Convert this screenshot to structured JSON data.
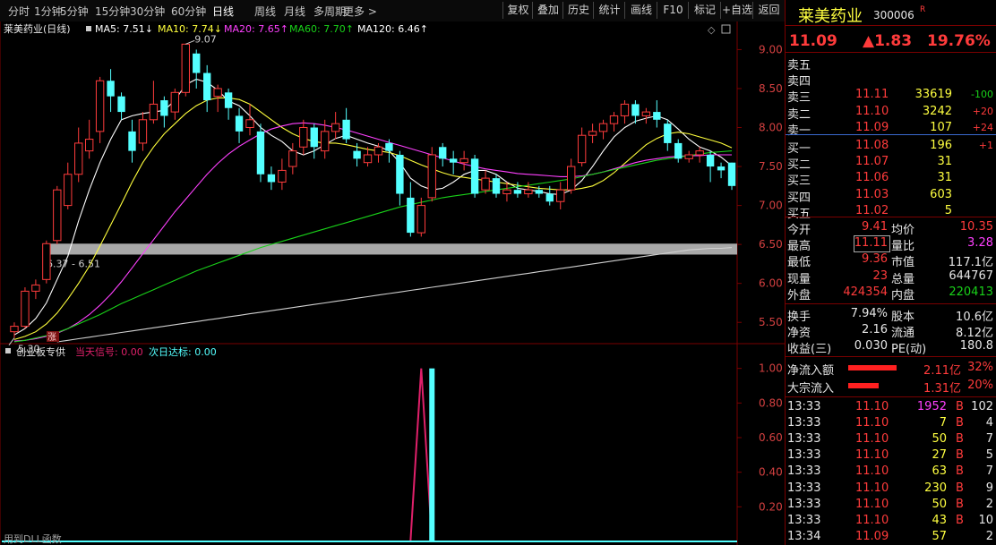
{
  "toolbar": {
    "periods": [
      "分时",
      "1分钟",
      "5分钟",
      "15分钟",
      "30分钟",
      "60分钟",
      "日线",
      "周线",
      "月线",
      "多周期",
      "更多 >"
    ],
    "active_period": "日线",
    "buttons": [
      "复权",
      "叠加",
      "历史",
      "统计",
      "画线",
      "F10",
      "标记",
      "+自选",
      "返回"
    ]
  },
  "chart_header": {
    "stock": "莱美药业(日线)",
    "ma5": "MA5: 7.51↓",
    "ma10": "MA10: 7.74↓",
    "ma20": "MA20: 7.65↑",
    "ma60": "MA60: 7.70↑",
    "ma120": "MA120: 6.46↑"
  },
  "sub_header": {
    "name": "创业板专供",
    "sig1": "当天信号: 0.00",
    "sig2": "次日达标: 0.00"
  },
  "bottom_text": "用到DLL函数",
  "colors": {
    "up": "#ff3c3c",
    "down": "#54ffff",
    "ma5": "#ffffff",
    "ma10": "#ffff3c",
    "ma20": "#ff40ff",
    "ma60": "#19d219",
    "ma120": "#d0d0d0",
    "grid": "#7a0000",
    "signal1": "#e0206a"
  },
  "chart_data": [
    {
      "type": "candlestick",
      "y_ticks": [
        5.5,
        6.0,
        6.5,
        7.0,
        7.5,
        8.0,
        8.5,
        9.0
      ],
      "ylim": [
        5.25,
        9.2
      ],
      "annotations": {
        "high_label": "9.07",
        "low_label": "5.30",
        "zone_label": "6.37 - 6.51",
        "zone": [
          6.37,
          6.51
        ],
        "marker": "涨"
      },
      "candles": [
        [
          5.38,
          5.45,
          5.3,
          5.5
        ],
        [
          5.45,
          5.9,
          5.42,
          5.95
        ],
        [
          5.9,
          5.98,
          5.8,
          6.05
        ],
        [
          6.05,
          6.51,
          6.0,
          6.55
        ],
        [
          6.55,
          7.2,
          6.5,
          7.25
        ],
        [
          7.0,
          7.4,
          6.95,
          7.55
        ],
        [
          7.4,
          7.8,
          7.3,
          8.0
        ],
        [
          7.7,
          7.85,
          7.6,
          8.1
        ],
        [
          7.95,
          8.6,
          7.8,
          8.65
        ],
        [
          8.6,
          8.4,
          8.2,
          8.75
        ],
        [
          8.4,
          8.2,
          8.1,
          8.45
        ],
        [
          7.95,
          7.7,
          7.55,
          8.1
        ],
        [
          7.8,
          8.1,
          7.7,
          8.2
        ],
        [
          8.1,
          8.3,
          8.05,
          8.6
        ],
        [
          8.35,
          8.15,
          8.0,
          8.4
        ],
        [
          8.2,
          8.45,
          8.1,
          8.5
        ],
        [
          8.45,
          9.07,
          8.4,
          9.07
        ],
        [
          8.95,
          8.7,
          8.5,
          9.0
        ],
        [
          8.7,
          8.35,
          8.2,
          8.8
        ],
        [
          8.4,
          8.5,
          8.2,
          8.55
        ],
        [
          8.45,
          8.25,
          8.1,
          8.5
        ],
        [
          8.15,
          7.95,
          7.8,
          8.25
        ],
        [
          8.0,
          8.1,
          7.9,
          8.3
        ],
        [
          7.95,
          7.4,
          7.3,
          8.05
        ],
        [
          7.4,
          7.3,
          7.2,
          7.5
        ],
        [
          7.3,
          7.45,
          7.2,
          7.6
        ],
        [
          7.5,
          7.7,
          7.4,
          7.8
        ],
        [
          7.75,
          8.0,
          7.65,
          8.1
        ],
        [
          8.0,
          7.75,
          7.6,
          8.05
        ],
        [
          7.7,
          7.95,
          7.6,
          8.1
        ],
        [
          7.95,
          8.05,
          7.85,
          8.2
        ],
        [
          8.1,
          7.85,
          7.8,
          8.25
        ],
        [
          7.7,
          7.6,
          7.5,
          7.8
        ],
        [
          7.55,
          7.65,
          7.5,
          7.75
        ],
        [
          7.65,
          7.75,
          7.55,
          7.8
        ],
        [
          7.8,
          7.7,
          7.55,
          7.85
        ],
        [
          7.65,
          7.15,
          7.0,
          7.7
        ],
        [
          7.1,
          6.65,
          6.6,
          7.3
        ],
        [
          6.65,
          7.0,
          6.6,
          7.1
        ],
        [
          7.1,
          7.65,
          7.05,
          7.75
        ],
        [
          7.75,
          7.6,
          7.5,
          7.8
        ],
        [
          7.6,
          7.55,
          7.4,
          7.7
        ],
        [
          7.55,
          7.6,
          7.45,
          7.7
        ],
        [
          7.6,
          7.15,
          7.1,
          7.65
        ],
        [
          7.2,
          7.35,
          7.15,
          7.45
        ],
        [
          7.35,
          7.15,
          7.1,
          7.4
        ],
        [
          7.15,
          7.2,
          7.05,
          7.3
        ],
        [
          7.2,
          7.15,
          7.1,
          7.3
        ],
        [
          7.15,
          7.2,
          7.1,
          7.3
        ],
        [
          7.2,
          7.15,
          7.1,
          7.25
        ],
        [
          7.15,
          7.05,
          7.0,
          7.25
        ],
        [
          7.05,
          7.2,
          6.95,
          7.3
        ],
        [
          7.2,
          7.5,
          7.15,
          7.6
        ],
        [
          7.55,
          7.9,
          7.5,
          8.0
        ],
        [
          7.9,
          7.95,
          7.8,
          8.05
        ],
        [
          7.95,
          8.05,
          7.85,
          8.1
        ],
        [
          8.05,
          8.15,
          7.95,
          8.2
        ],
        [
          8.15,
          8.3,
          8.05,
          8.35
        ],
        [
          8.3,
          8.15,
          8.05,
          8.35
        ],
        [
          8.15,
          8.2,
          8.05,
          8.25
        ],
        [
          8.2,
          8.1,
          8.0,
          8.35
        ],
        [
          8.05,
          7.8,
          7.7,
          8.1
        ],
        [
          7.8,
          7.6,
          7.55,
          7.85
        ],
        [
          7.6,
          7.65,
          7.55,
          7.7
        ],
        [
          7.65,
          7.7,
          7.55,
          7.75
        ],
        [
          7.65,
          7.5,
          7.3,
          7.7
        ],
        [
          7.5,
          7.45,
          7.35,
          7.55
        ],
        [
          7.55,
          7.25,
          7.2,
          7.55
        ]
      ],
      "series": [
        {
          "key": "ma5",
          "values": [
            5.34,
            5.42,
            5.55,
            5.75,
            6.05,
            6.35,
            6.8,
            7.2,
            7.55,
            7.85,
            8.1,
            8.15,
            8.18,
            8.2,
            8.22,
            8.35,
            8.55,
            8.62,
            8.58,
            8.48,
            8.34,
            8.28,
            8.15,
            8.0,
            7.9,
            7.82,
            7.7,
            7.65,
            7.7,
            7.78,
            7.86,
            7.9,
            7.85,
            7.8,
            7.76,
            7.7,
            7.55,
            7.35,
            7.25,
            7.2,
            7.22,
            7.3,
            7.4,
            7.45,
            7.45,
            7.4,
            7.3,
            7.22,
            7.2,
            7.18,
            7.15,
            7.14,
            7.2,
            7.32,
            7.5,
            7.7,
            7.88,
            8.0,
            8.08,
            8.12,
            8.15,
            8.1,
            7.98,
            7.85,
            7.75,
            7.7,
            7.62,
            7.51
          ]
        },
        {
          "key": "ma10",
          "values": [
            5.28,
            5.32,
            5.38,
            5.48,
            5.62,
            5.8,
            6.0,
            6.22,
            6.48,
            6.75,
            7.02,
            7.3,
            7.55,
            7.75,
            7.92,
            8.05,
            8.18,
            8.28,
            8.35,
            8.38,
            8.38,
            8.36,
            8.3,
            8.2,
            8.1,
            8.0,
            7.92,
            7.86,
            7.82,
            7.8,
            7.8,
            7.78,
            7.75,
            7.72,
            7.7,
            7.68,
            7.64,
            7.58,
            7.52,
            7.47,
            7.42,
            7.38,
            7.36,
            7.34,
            7.32,
            7.3,
            7.28,
            7.26,
            7.24,
            7.22,
            7.21,
            7.2,
            7.2,
            7.22,
            7.25,
            7.32,
            7.42,
            7.54,
            7.66,
            7.78,
            7.86,
            7.92,
            7.94,
            7.92,
            7.88,
            7.84,
            7.8,
            7.74
          ]
        },
        {
          "key": "ma20",
          "values": [
            5.26,
            5.27,
            5.29,
            5.32,
            5.36,
            5.42,
            5.5,
            5.6,
            5.72,
            5.86,
            6.02,
            6.2,
            6.38,
            6.56,
            6.74,
            6.92,
            7.08,
            7.24,
            7.4,
            7.54,
            7.66,
            7.76,
            7.84,
            7.92,
            7.98,
            8.02,
            8.05,
            8.06,
            8.05,
            8.03,
            8.0,
            7.97,
            7.93,
            7.89,
            7.85,
            7.81,
            7.77,
            7.73,
            7.69,
            7.65,
            7.61,
            7.57,
            7.53,
            7.5,
            7.47,
            7.45,
            7.43,
            7.41,
            7.4,
            7.39,
            7.38,
            7.37,
            7.37,
            7.38,
            7.4,
            7.43,
            7.47,
            7.51,
            7.55,
            7.58,
            7.6,
            7.62,
            7.63,
            7.64,
            7.64,
            7.65,
            7.65,
            7.65
          ]
        },
        {
          "key": "ma60",
          "values": [
            5.25,
            5.27,
            5.3,
            5.33,
            5.37,
            5.42,
            5.48,
            5.54,
            5.6,
            5.67,
            5.74,
            5.8,
            5.86,
            5.92,
            5.98,
            6.04,
            6.1,
            6.16,
            6.21,
            6.26,
            6.31,
            6.36,
            6.41,
            6.46,
            6.5,
            6.54,
            6.58,
            6.62,
            6.66,
            6.7,
            6.74,
            6.78,
            6.82,
            6.86,
            6.9,
            6.94,
            6.98,
            7.01,
            7.04,
            7.07,
            7.1,
            7.12,
            7.14,
            7.16,
            7.18,
            7.2,
            7.22,
            7.24,
            7.26,
            7.28,
            7.3,
            7.32,
            7.34,
            7.37,
            7.4,
            7.43,
            7.46,
            7.49,
            7.52,
            7.55,
            7.58,
            7.6,
            7.62,
            7.64,
            7.66,
            7.68,
            7.69,
            7.7
          ]
        },
        {
          "key": "ma120",
          "values": [
            null,
            null,
            null,
            null,
            5.25,
            5.27,
            5.29,
            5.31,
            5.33,
            5.35,
            5.37,
            5.39,
            5.41,
            5.43,
            5.45,
            5.47,
            5.49,
            5.51,
            5.53,
            5.55,
            5.57,
            5.59,
            5.61,
            5.63,
            5.65,
            5.67,
            5.69,
            5.71,
            5.73,
            5.75,
            5.77,
            5.79,
            5.81,
            5.83,
            5.85,
            5.87,
            5.89,
            5.91,
            5.93,
            5.95,
            5.97,
            5.99,
            6.01,
            6.03,
            6.05,
            6.07,
            6.09,
            6.11,
            6.13,
            6.15,
            6.17,
            6.19,
            6.21,
            6.23,
            6.25,
            6.27,
            6.29,
            6.31,
            6.33,
            6.35,
            6.37,
            6.39,
            6.41,
            6.43,
            6.44,
            6.45,
            6.45,
            6.46
          ]
        }
      ]
    },
    {
      "type": "line",
      "y_ticks": [
        0.2,
        0.4,
        0.6,
        0.8,
        1.0
      ],
      "ylim": [
        0,
        1.05
      ],
      "signal_today": [
        0,
        0,
        0,
        0,
        0,
        0,
        0,
        0,
        0,
        0,
        0,
        0,
        0,
        0,
        0,
        0,
        0,
        0,
        0,
        0,
        0,
        0,
        0,
        0,
        0,
        0,
        0,
        0,
        0,
        0,
        0,
        0,
        0,
        0,
        0,
        0,
        0,
        0,
        1,
        0,
        0,
        0,
        0,
        0,
        0,
        0,
        0,
        0,
        0,
        0,
        0,
        0,
        0,
        0,
        0,
        0,
        0,
        0,
        0,
        0,
        0,
        0,
        0,
        0,
        0,
        0,
        0,
        0
      ],
      "signal_next": [
        0,
        0,
        0,
        0,
        0,
        0,
        0,
        0,
        0,
        0,
        0,
        0,
        0,
        0,
        0,
        0,
        0,
        0,
        0,
        0,
        0,
        0,
        0,
        0,
        0,
        0,
        0,
        0,
        0,
        0,
        0,
        0,
        0,
        0,
        0,
        0,
        0,
        0,
        0,
        1,
        0,
        0,
        0,
        0,
        0,
        0,
        0,
        0,
        0,
        0,
        0,
        0,
        0,
        0,
        0,
        0,
        0,
        0,
        0,
        0,
        0,
        0,
        0,
        0,
        0,
        0,
        0,
        0
      ]
    }
  ],
  "quote": {
    "name": "莱美药业",
    "code": "300006",
    "badge": "R",
    "price": "11.09",
    "change": "▲1.83",
    "pct": "19.76%",
    "asks": [
      {
        "label": "卖五",
        "price": "",
        "vol": "",
        "chg": ""
      },
      {
        "label": "卖四",
        "price": "",
        "vol": "",
        "chg": ""
      },
      {
        "label": "卖三",
        "price": "11.11",
        "vol": "33619",
        "chg": "-100"
      },
      {
        "label": "卖二",
        "price": "11.10",
        "vol": "3242",
        "chg": "+20"
      },
      {
        "label": "卖一",
        "price": "11.09",
        "vol": "107",
        "chg": "+24"
      }
    ],
    "bids": [
      {
        "label": "买一",
        "price": "11.08",
        "vol": "196",
        "chg": "+1"
      },
      {
        "label": "买二",
        "price": "11.07",
        "vol": "31",
        "chg": ""
      },
      {
        "label": "买三",
        "price": "11.06",
        "vol": "31",
        "chg": ""
      },
      {
        "label": "买四",
        "price": "11.03",
        "vol": "603",
        "chg": ""
      },
      {
        "label": "买五",
        "price": "11.02",
        "vol": "5",
        "chg": ""
      }
    ],
    "stats1": [
      {
        "l1": "今开",
        "v1": "9.41",
        "l2": "均价",
        "v2": "10.35",
        "c1": "red",
        "c2": "red"
      },
      {
        "l1": "最高",
        "v1": "11.11",
        "l2": "量比",
        "v2": "3.28",
        "c1": "red",
        "c2": "mag"
      },
      {
        "l1": "最低",
        "v1": "9.36",
        "l2": "市值",
        "v2": "117.1亿",
        "c1": "red",
        "c2": "wht"
      },
      {
        "l1": "现量",
        "v1": "23",
        "l2": "总量",
        "v2": "644767",
        "c1": "red",
        "c2": "wht"
      },
      {
        "l1": "外盘",
        "v1": "424354",
        "l2": "内盘",
        "v2": "220413",
        "c1": "red",
        "c2": "grn"
      }
    ],
    "stats2": [
      {
        "l1": "换手",
        "v1": "7.94%",
        "l2": "股本",
        "v2": "10.6亿"
      },
      {
        "l1": "净资",
        "v1": "2.16",
        "l2": "流通",
        "v2": "8.12亿"
      },
      {
        "l1": "收益(三)",
        "v1": "0.030",
        "l2": "PE(动)",
        "v2": "180.8"
      }
    ],
    "flows": [
      {
        "label": "净流入额",
        "value": "2.11亿",
        "pct": "32%",
        "frac": 0.32
      },
      {
        "label": "大宗流入",
        "value": "1.31亿",
        "pct": "20%",
        "frac": 0.2
      }
    ],
    "trades": [
      {
        "t": "13:33",
        "p": "11.10",
        "v": "1952",
        "s": "B",
        "n": "102"
      },
      {
        "t": "13:33",
        "p": "11.10",
        "v": "7",
        "s": "B",
        "n": "4"
      },
      {
        "t": "13:33",
        "p": "11.10",
        "v": "50",
        "s": "B",
        "n": "7"
      },
      {
        "t": "13:33",
        "p": "11.10",
        "v": "27",
        "s": "B",
        "n": "5"
      },
      {
        "t": "13:33",
        "p": "11.10",
        "v": "63",
        "s": "B",
        "n": "7"
      },
      {
        "t": "13:33",
        "p": "11.10",
        "v": "230",
        "s": "B",
        "n": "9"
      },
      {
        "t": "13:33",
        "p": "11.10",
        "v": "50",
        "s": "B",
        "n": "2"
      },
      {
        "t": "13:33",
        "p": "11.10",
        "v": "43",
        "s": "B",
        "n": "10"
      },
      {
        "t": "13:34",
        "p": "11.09",
        "v": "57",
        "s": "",
        "n": "2"
      }
    ]
  }
}
